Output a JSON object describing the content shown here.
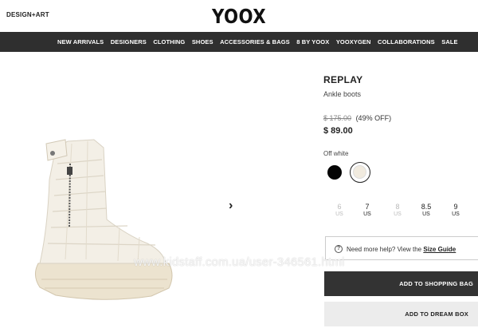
{
  "header": {
    "design_art": "DESIGN+ART",
    "logo": "YOOX"
  },
  "nav": {
    "items": [
      "NEW ARRIVALS",
      "DESIGNERS",
      "CLOTHING",
      "SHOES",
      "ACCESSORIES & BAGS",
      "8 BY YOOX",
      "YOOXYGEN",
      "COLLABORATIONS",
      "SALE"
    ]
  },
  "product": {
    "brand": "REPLAY",
    "category": "Ankle boots",
    "old_price": "$ 175.00",
    "discount": "(49% OFF)",
    "price": "$ 89.00",
    "color_label": "Off white",
    "colors": [
      {
        "name": "black",
        "hex": "#050505",
        "selected": false
      },
      {
        "name": "off white",
        "hex": "#f1ebdf",
        "selected": true
      }
    ],
    "sizes": [
      {
        "size": "6",
        "unit": "US",
        "available": false
      },
      {
        "size": "7",
        "unit": "US",
        "available": true
      },
      {
        "size": "8",
        "unit": "US",
        "available": false
      },
      {
        "size": "8.5",
        "unit": "US",
        "available": true
      },
      {
        "size": "9",
        "unit": "US",
        "available": true
      }
    ]
  },
  "help": {
    "text": "Need more help? View the ",
    "link": "Size Guide"
  },
  "buttons": {
    "add_to_bag": "ADD TO SHOPPING BAG",
    "add_to_dream_box": "ADD TO DREAM BOX"
  },
  "gallery": {
    "next_icon": "chevron-right-icon"
  },
  "watermark": "www.kidstaff.com.ua/user-346561.html",
  "colors": {
    "nav_bg": "#2f2f2f",
    "primary_button": "#333333",
    "secondary_button": "#ececec"
  }
}
